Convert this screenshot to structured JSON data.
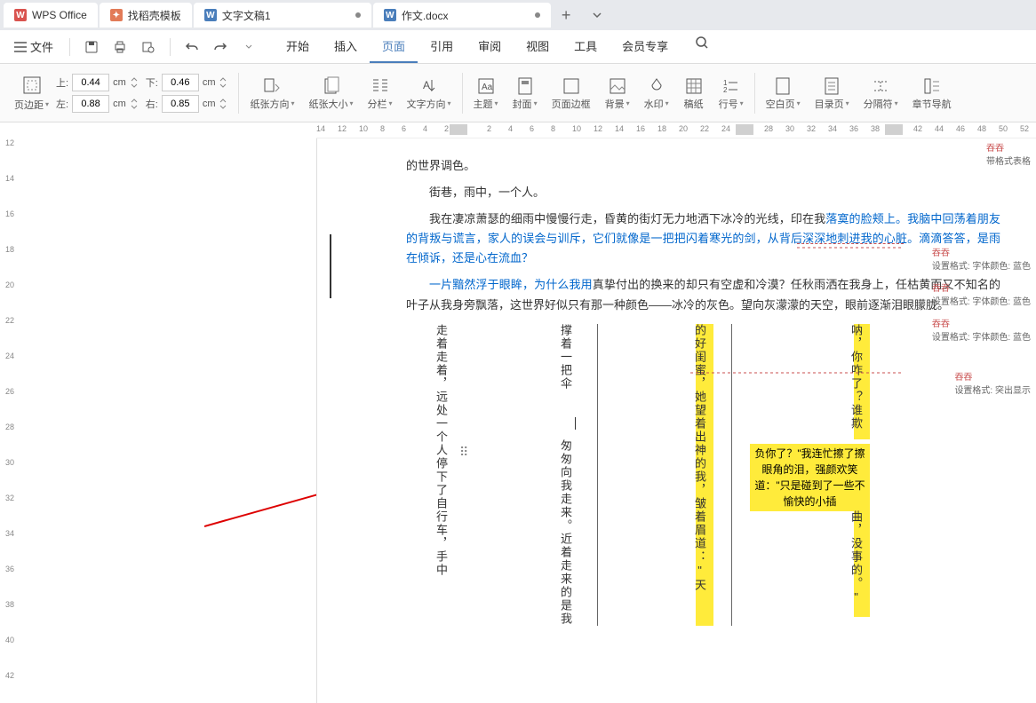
{
  "tabs": {
    "wps": "WPS Office",
    "t1": "找稻壳模板",
    "t2": "文字文稿1",
    "t3": "作文.docx"
  },
  "menu": {
    "file": "文件",
    "items": [
      "开始",
      "插入",
      "页面",
      "引用",
      "审阅",
      "视图",
      "工具",
      "会员专享"
    ],
    "active_index": 2
  },
  "toolbar": {
    "margin_label": "页边距",
    "top_label": "上:",
    "top_val": "0.44",
    "top_unit": "cm",
    "bottom_label": "下:",
    "bottom_val": "0.46",
    "bottom_unit": "cm",
    "left_label": "左:",
    "left_val": "0.88",
    "left_unit": "cm",
    "right_label": "右:",
    "right_val": "0.85",
    "right_unit": "cm",
    "orient": "纸张方向",
    "size": "纸张大小",
    "columns": "分栏",
    "textdir": "文字方向",
    "theme": "主题",
    "cover": "封面",
    "border": "页面边框",
    "bg": "背景",
    "watermark": "水印",
    "grid": "稿纸",
    "lineno": "行号",
    "blank": "空白页",
    "toc": "目录页",
    "break": "分隔符",
    "chapternav": "章节导航"
  },
  "ruler": {
    "h_ticks": [
      14,
      12,
      10,
      8,
      6,
      4,
      2,
      "",
      2,
      4,
      6,
      8,
      10,
      12,
      14,
      16,
      18,
      20,
      22,
      24,
      26,
      28,
      30,
      32,
      34,
      36,
      38,
      40,
      42,
      44,
      46,
      48,
      50,
      52
    ],
    "v_ticks": [
      12,
      14,
      16,
      18,
      20,
      22,
      24,
      26,
      28,
      30,
      32,
      34,
      36,
      38,
      40,
      42
    ]
  },
  "doc": {
    "p1": "的世界调色。",
    "p2": "街巷，雨中，一个人。",
    "p3_pre": "我在凄凉萧瑟的细雨中慢慢行走，昏黄的街灯无力地洒下冰冷的光线，印在我",
    "p3_blue": "落寞的脸颊上。我脑中回荡着朋友的背叛与谎言，家人的误会与训斥，它们就像是一把把闪着寒光的剑，从背后深深地刺进我的心脏。滴滴答答，是雨在倾诉，还是心在流血？",
    "p4_blue": "一片黯然浮于眼眸，为什么我用",
    "p4_rest": "真挚付出的换来的却只有空虚和冷漠？任秋雨洒在我身上，任枯黄而又不知名的叶子从我身旁飘落，这世界好似只有那一种颜色——冰冷的灰色。望向灰濛濛的天空，眼前逐渐泪眼朦胧。",
    "col1": "走着走着，远处一个人停下了自行车，手中",
    "col2a": "撑着一把伞",
    "col2b": "匆匆向我走来。近着走来的是我",
    "col3": "的好闺蜜，她望着出神的我，皱着眉道：\"天",
    "col4a": "呐，你咋了？谁欺",
    "col4_block": "负你了？\"我连忙擦了擦眼角的泪，强颜欢笑道：\"只是碰到了一些不愉快的小插",
    "col4b": "曲，没事的。\""
  },
  "annotations": {
    "a0_title": "吞吞",
    "a0_desc": "带格式表格",
    "a1_title": "吞吞",
    "a1_desc": "设置格式: 字体颜色: 蓝色",
    "a2_title": "吞吞",
    "a2_desc": "设置格式: 字体颜色: 蓝色",
    "a3_title": "吞吞",
    "a3_desc": "设置格式: 字体颜色: 蓝色",
    "a4_title": "吞吞",
    "a4_desc": "设置格式: 突出显示"
  }
}
